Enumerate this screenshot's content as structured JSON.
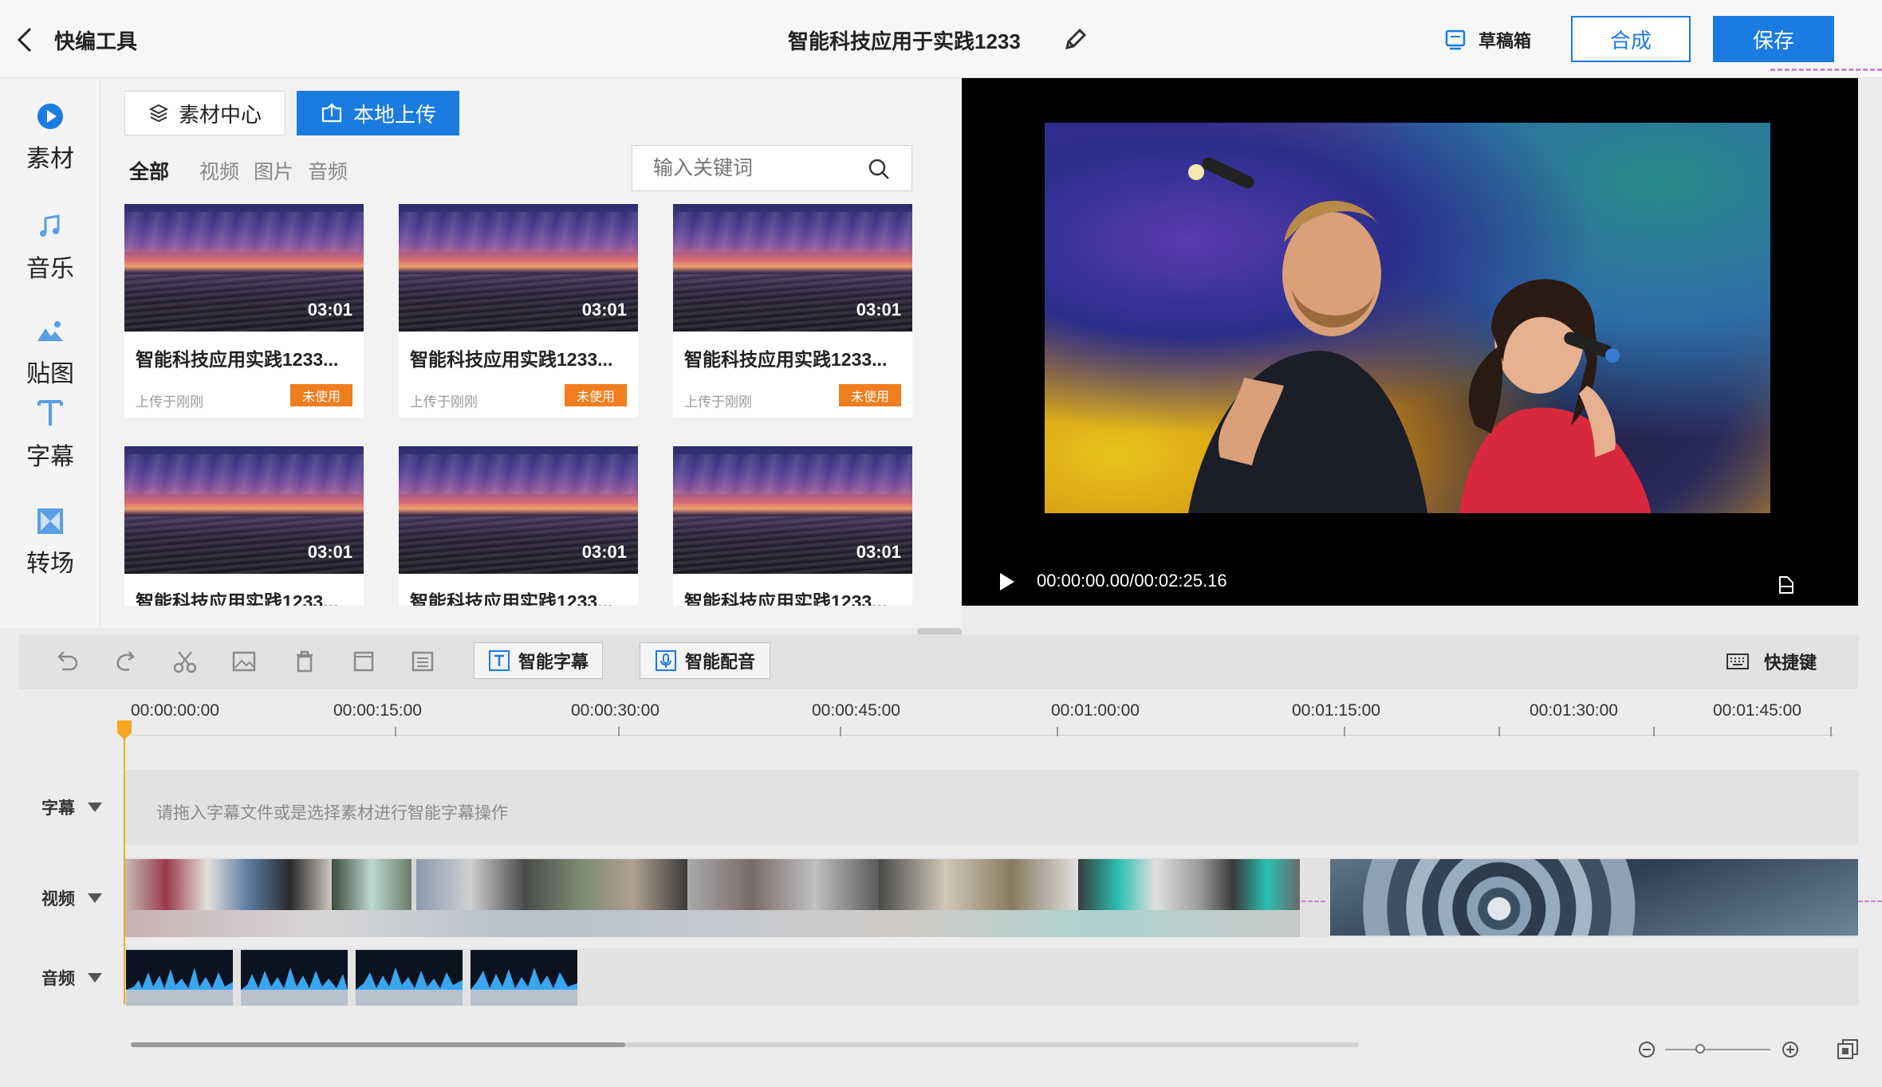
{
  "header": {
    "app_title": "快编工具",
    "project_title": "智能科技应用于实践1233",
    "drafts_label": "草稿箱",
    "compose_label": "合成",
    "save_label": "保存"
  },
  "sidebar": {
    "items": [
      {
        "label": "素材",
        "icon": "play-circle-icon",
        "active": true
      },
      {
        "label": "音乐",
        "icon": "music-note-icon"
      },
      {
        "label": "贴图",
        "icon": "mountain-image-icon"
      },
      {
        "label": "字幕",
        "icon": "text-t-icon"
      },
      {
        "label": "转场",
        "icon": "transition-icon"
      }
    ]
  },
  "library": {
    "tab_material": "素材中心",
    "tab_upload": "本地上传",
    "filters": [
      "全部",
      "视频",
      "图片",
      "音频"
    ],
    "search_placeholder": "输入关键词",
    "cards": [
      {
        "title": "智能科技应用实践1233...",
        "duration": "03:01",
        "subtitle": "上传于刚刚",
        "badge": "未使用"
      },
      {
        "title": "智能科技应用实践1233...",
        "duration": "03:01",
        "subtitle": "上传于刚刚",
        "badge": "未使用"
      },
      {
        "title": "智能科技应用实践1233...",
        "duration": "03:01",
        "subtitle": "上传于刚刚",
        "badge": "未使用"
      },
      {
        "title": "智能科技应用实践1233...",
        "duration": "03:01"
      },
      {
        "title": "智能科技应用实践1233...",
        "duration": "03:01"
      },
      {
        "title": "智能科技应用实践1233...",
        "duration": "03:01"
      }
    ]
  },
  "preview": {
    "time": "00:00:00.00/00:02:25.16"
  },
  "toolbar": {
    "smart_subtitle": "智能字幕",
    "smart_dub": "智能配音",
    "shortcut": "快捷键"
  },
  "timeline": {
    "ticks": [
      "00:00:00:00",
      "00:00:15:00",
      "00:00:30:00",
      "00:00:45:00",
      "00:01:00:00",
      "00:01:15:00",
      "00:01:30:00",
      "00:01:45:00"
    ],
    "tracks": {
      "subtitle": "字幕",
      "video": "视频",
      "audio": "音频"
    },
    "subtitle_hint": "请拖入字幕文件或是选择素材进行智能字幕操作"
  },
  "colors": {
    "accent": "#1a7be0",
    "badge": "#f07d1e",
    "playhead": "#f5a623"
  }
}
